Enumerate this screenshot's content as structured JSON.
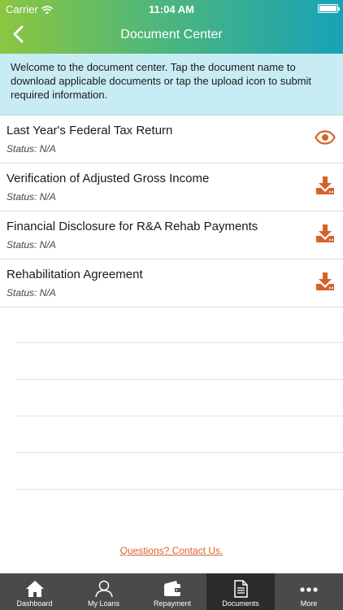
{
  "status_bar": {
    "carrier": "Carrier",
    "time": "11:04 AM"
  },
  "nav": {
    "title": "Document Center"
  },
  "intro": {
    "text": "Welcome to the document center. Tap the document name to download applicable documents or tap the upload icon to submit required information."
  },
  "documents": [
    {
      "name": "Last Year's Federal Tax Return",
      "status": "Status: N/A",
      "action_icon": "eye-icon"
    },
    {
      "name": "Verification of Adjusted Gross Income",
      "status": "Status: N/A",
      "action_icon": "download-icon"
    },
    {
      "name": "Financial Disclosure for R&A Rehab Payments",
      "status": "Status: N/A",
      "action_icon": "download-icon"
    },
    {
      "name": "Rehabilitation Agreement",
      "status": "Status: N/A",
      "action_icon": "download-icon"
    }
  ],
  "contact": {
    "label": "Questions? Contact Us."
  },
  "tabbar": {
    "tabs": [
      {
        "label": "Dashboard",
        "icon": "home-icon"
      },
      {
        "label": "My Loans",
        "icon": "person-icon"
      },
      {
        "label": "Repayment",
        "icon": "wallet-icon"
      },
      {
        "label": "Documents",
        "icon": "document-icon",
        "active": true
      },
      {
        "label": "More",
        "icon": "more-icon"
      }
    ]
  },
  "colors": {
    "accent": "#d9622b",
    "header_gradient_start": "#8cc63f",
    "header_gradient_end": "#17a2b8",
    "intro_background": "#c8ecf3",
    "tabbar_background": "#4a4a4a",
    "tabbar_active": "#2b2b2b"
  }
}
